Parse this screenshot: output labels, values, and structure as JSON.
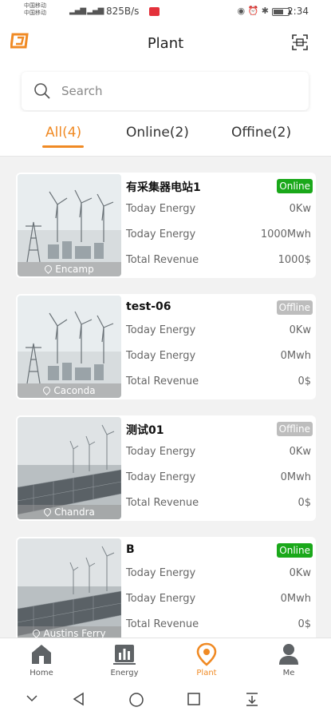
{
  "status_bar": {
    "carrier_1": "中国移动",
    "carrier_2": "中国移动",
    "speed": "825B/s",
    "time": "2:34"
  },
  "header": {
    "title": "Plant"
  },
  "search": {
    "placeholder": "Search"
  },
  "tabs": [
    {
      "label": "All(4)",
      "active": true
    },
    {
      "label": "Online(2)",
      "active": false
    },
    {
      "label": "Offine(2)",
      "active": false
    }
  ],
  "plants": [
    {
      "name": "有采集器电站1",
      "status": "Online",
      "location": "Encamp",
      "image": "wind-substation",
      "rows": [
        {
          "label": "Today Energy",
          "value": "0Kw"
        },
        {
          "label": "Today Energy",
          "value": "1000Mwh"
        },
        {
          "label": "Total Revenue",
          "value": "1000$"
        }
      ]
    },
    {
      "name": "test-06",
      "status": "Offline",
      "location": "Caconda",
      "image": "wind-substation",
      "rows": [
        {
          "label": "Today Energy",
          "value": "0Kw"
        },
        {
          "label": "Today Energy",
          "value": "0Mwh"
        },
        {
          "label": "Total Revenue",
          "value": "0$"
        }
      ]
    },
    {
      "name": "测试01",
      "status": "Offline",
      "location": "Chandra",
      "image": "solar-wind",
      "rows": [
        {
          "label": "Today Energy",
          "value": "0Kw"
        },
        {
          "label": "Today Energy",
          "value": "0Mwh"
        },
        {
          "label": "Total Revenue",
          "value": "0$"
        }
      ]
    },
    {
      "name": "B",
      "status": "Online",
      "location": "Austins Ferry",
      "image": "solar-wind",
      "rows": [
        {
          "label": "Today Energy",
          "value": "0Kw"
        },
        {
          "label": "Today Energy",
          "value": "0Mwh"
        },
        {
          "label": "Total Revenue",
          "value": "0$"
        }
      ]
    }
  ],
  "bottom_nav": [
    {
      "label": "Home",
      "icon": "home-icon",
      "active": false
    },
    {
      "label": "Energy",
      "icon": "energy-icon",
      "active": false
    },
    {
      "label": "Plant",
      "icon": "location-pin-icon",
      "active": true
    },
    {
      "label": "Me",
      "icon": "user-icon",
      "active": false
    }
  ],
  "colors": {
    "accent": "#f08a24",
    "online": "#1aa81a",
    "offline": "#bdbdbd"
  }
}
